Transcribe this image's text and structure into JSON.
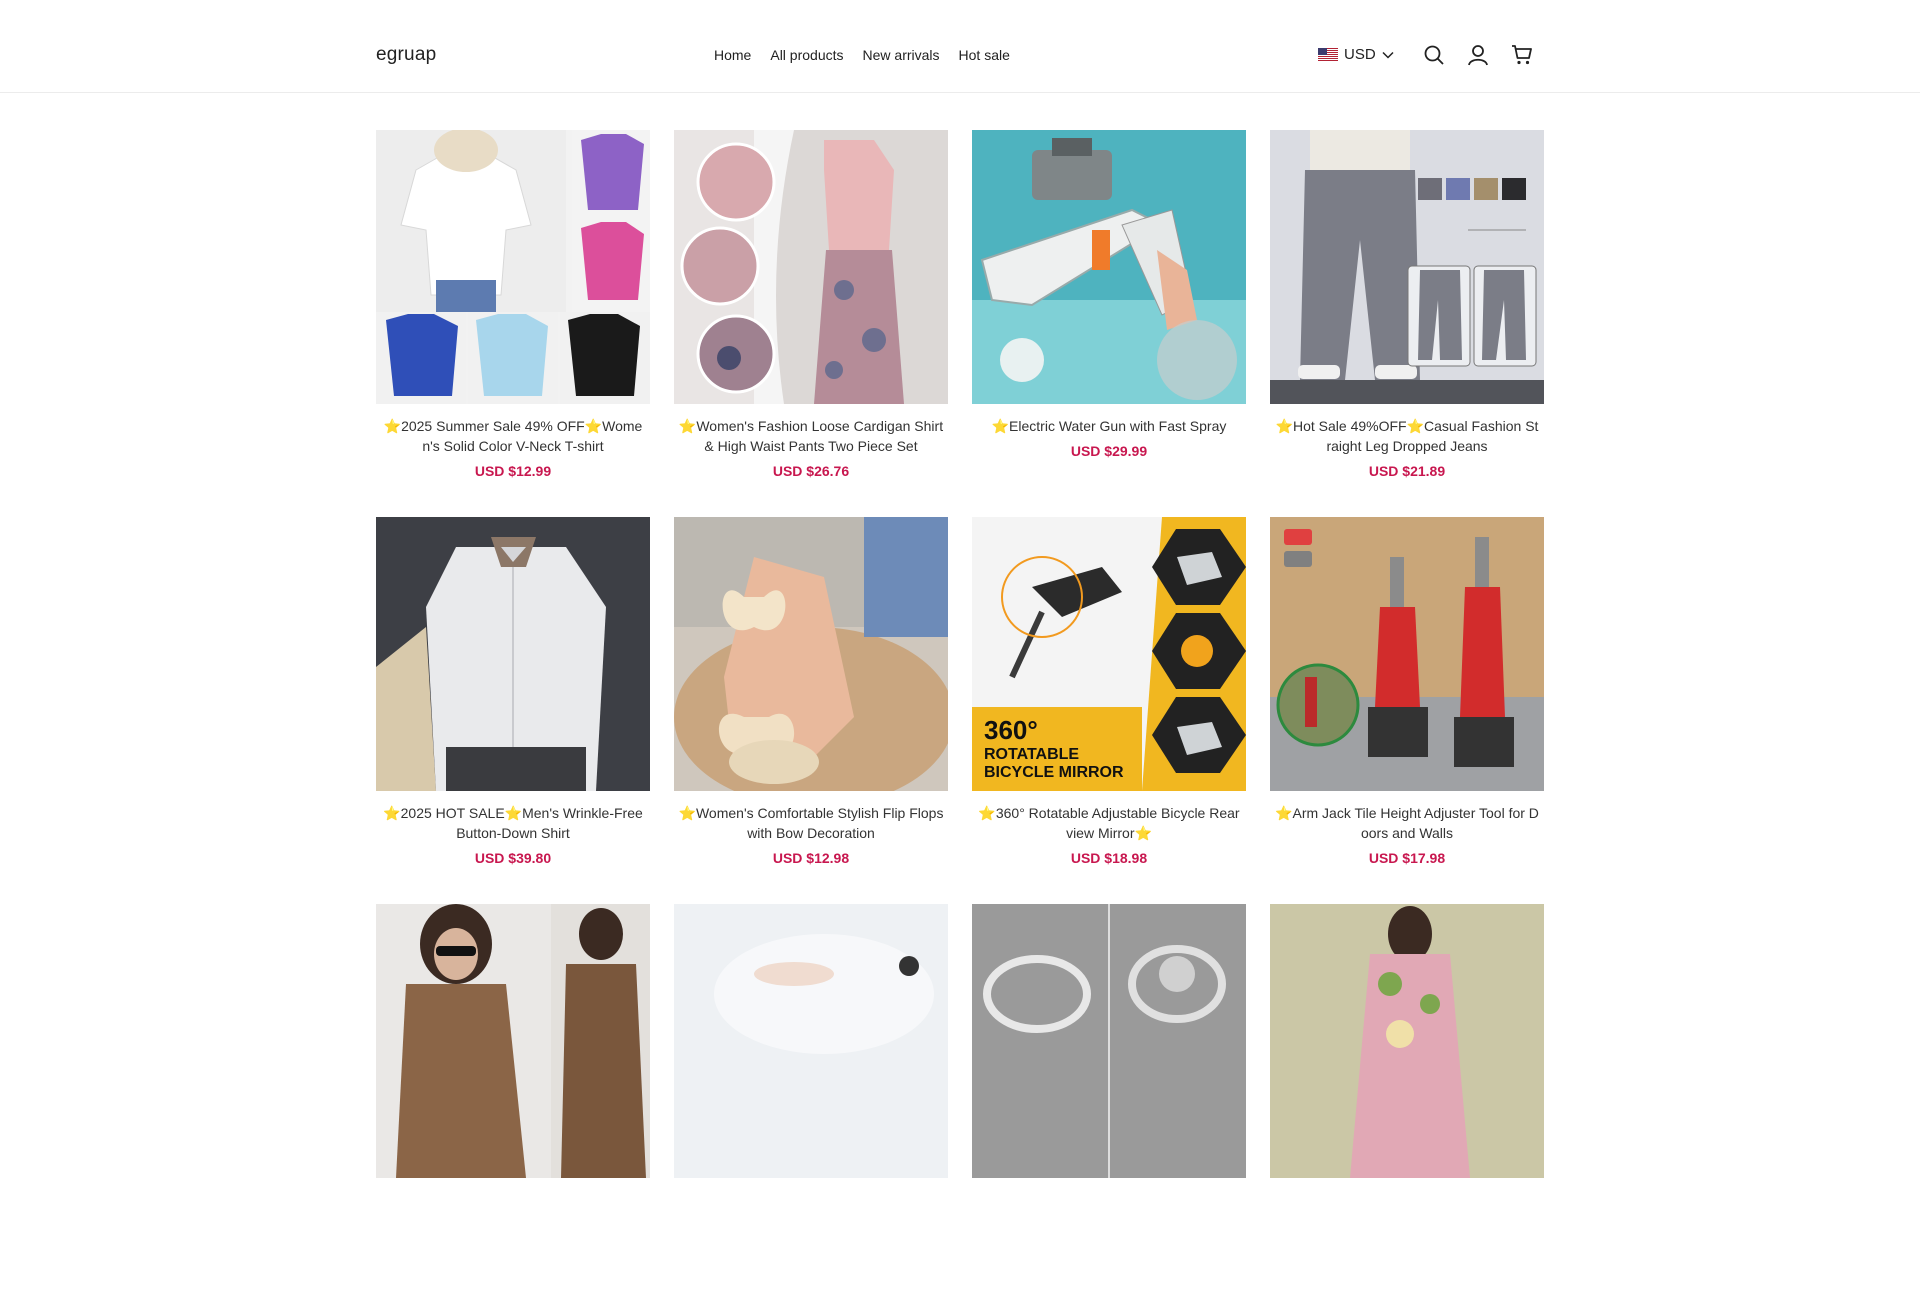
{
  "header": {
    "logo": "egruap",
    "nav": [
      "Home",
      "All products",
      "New arrivals",
      "Hot sale"
    ],
    "currency": "USD",
    "icons": [
      "us-flag-icon",
      "chevron-down-icon",
      "search-icon",
      "account-icon",
      "cart-icon"
    ]
  },
  "products": [
    {
      "title": "⭐2025 Summer Sale 49% OFF⭐Women's Solid Color V-Neck T-shirt",
      "price": "USD $12.99"
    },
    {
      "title": "⭐Women's Fashion Loose Cardigan Shirt & High Waist Pants Two Piece Set",
      "price": "USD $26.76"
    },
    {
      "title": "⭐Electric Water Gun with Fast Spray",
      "price": "USD $29.99"
    },
    {
      "title": "⭐Hot Sale 49%OFF⭐Casual Fashion Straight Leg Dropped Jeans",
      "price": "USD $21.89"
    },
    {
      "title": "⭐2025 HOT SALE⭐Men's Wrinkle-Free Button-Down Shirt",
      "price": "USD $39.80"
    },
    {
      "title": "⭐Women's Comfortable Stylish Flip Flops with Bow Decoration",
      "price": "USD $12.98"
    },
    {
      "title": "⭐360° Rotatable Adjustable Bicycle Rear view Mirror⭐",
      "price": "USD $18.98"
    },
    {
      "title": "⭐Arm Jack Tile Height Adjuster Tool for Doors and Walls",
      "price": "USD $17.98"
    },
    {
      "title": "",
      "price": ""
    },
    {
      "title": "",
      "price": ""
    },
    {
      "title": "",
      "price": ""
    },
    {
      "title": "",
      "price": ""
    }
  ],
  "image_texts": {
    "mirror_banner_line1": "360°",
    "mirror_banner_line2": "ROTATABLE",
    "mirror_banner_line3": "BICYCLE MIRROR"
  },
  "colors": {
    "price": "#c8174f",
    "border": "#ececec",
    "text": "#222222"
  }
}
